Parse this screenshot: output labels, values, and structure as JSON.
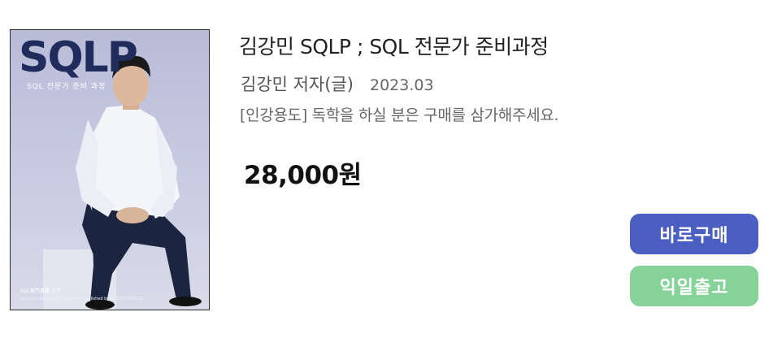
{
  "cover": {
    "title": "SQLP",
    "subtitle": "SQL 전문가 준비 과정",
    "footer_line1": "SQL專門書籍 です",
    "footer_line2": "lecture note by Kim Kangmin · Published by 2023.03 SMP:18"
  },
  "product": {
    "title": "김강민 SQLP  ; SQL 전문가 준비과정",
    "author": "김강민 저자(글)",
    "date": "2023.03",
    "description": "[인강용도]  독학을 하실 분은 구매를 삼가해주세요.",
    "price": "28,000원"
  },
  "actions": {
    "buy_label": "바로구매",
    "ship_label": "익일출고"
  },
  "colors": {
    "buy_button": "#4a5fc1",
    "ship_button": "#86d39a",
    "cover_title": "#1f2c5c"
  }
}
